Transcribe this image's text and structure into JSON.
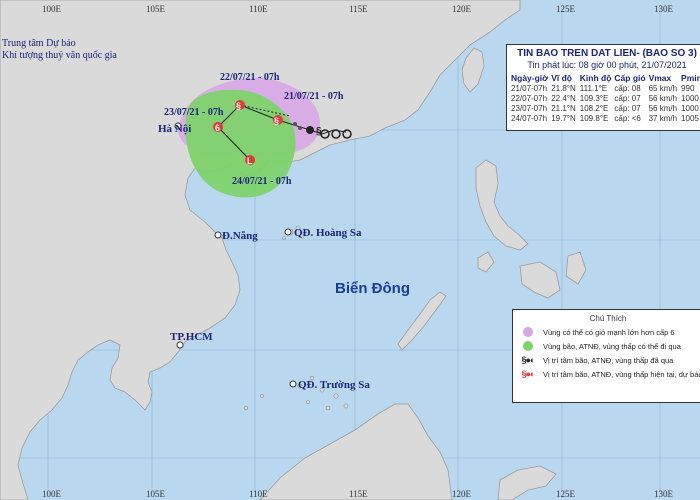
{
  "map": {
    "lon_labels": [
      "100E",
      "105E",
      "110E",
      "115E",
      "120E",
      "125E",
      "130E"
    ],
    "places": {
      "hanoi": "Hà Nội",
      "danang": "Đ.Nẵng",
      "hcm": "TP.HCM",
      "hoangsa": "QĐ. Hoàng Sa",
      "truongsa": "QĐ. Trường Sa"
    },
    "sea_name": "Biển Đông",
    "track_times": [
      "21/07/21 - 07h",
      "22/07/21 - 07h",
      "23/07/21 - 07h",
      "24/07/21 - 07h"
    ],
    "colors": {
      "sea": "#b9d8f0",
      "land": "#dadada",
      "danger_zone": "#d7a6e6",
      "storm_zone": "#7ed36b",
      "storm_symbol": "#e53935"
    }
  },
  "agency": {
    "line1": "Trung tâm Dự báo",
    "line2": "Khí tượng thuỷ văn quốc gia"
  },
  "bulletin": {
    "title": "TIN BAO TREN DAT LIEN- (BAO SO 3)",
    "issued": "Tin phát lúc: 08 giờ 00 phút, 21/07/2021",
    "headers": [
      "Ngày-giờ",
      "Vĩ độ",
      "Kinh độ",
      "Cấp gió",
      "Vmax",
      "Pmin"
    ],
    "rows": [
      [
        "21/07-07h",
        "21.8°N",
        "111.1°E",
        "cấp: 08",
        "65 km/h",
        "990"
      ],
      [
        "22/07-07h",
        "22.4°N",
        "109.3°E",
        "cấp: 07",
        "56 km/h",
        "1000"
      ],
      [
        "23/07-07h",
        "21.1°N",
        "108.2°E",
        "cấp: 07",
        "56 km/h",
        "1000"
      ],
      [
        "24/07-07h",
        "19.7°N",
        "109.8°E",
        "cấp: <6",
        "37 km/h",
        "1005"
      ]
    ]
  },
  "legend": {
    "title": "Chú Thích",
    "items": [
      {
        "text": "Vùng có thể có gió mạnh lớn hơn cấp 6",
        "icon": "purple-dot-icon"
      },
      {
        "text": "Vùng bão, ATNĐ, vùng thấp có thể đi qua",
        "icon": "green-dot-icon"
      },
      {
        "text": "Vị trí tâm bão, ATNĐ, vùng thấp đã qua",
        "icon": "past-center-icon"
      },
      {
        "text": "Vị trí tâm bão, ATNĐ, vùng thấp hiện tại, dự báo",
        "icon": "forecast-center-icon"
      }
    ]
  }
}
